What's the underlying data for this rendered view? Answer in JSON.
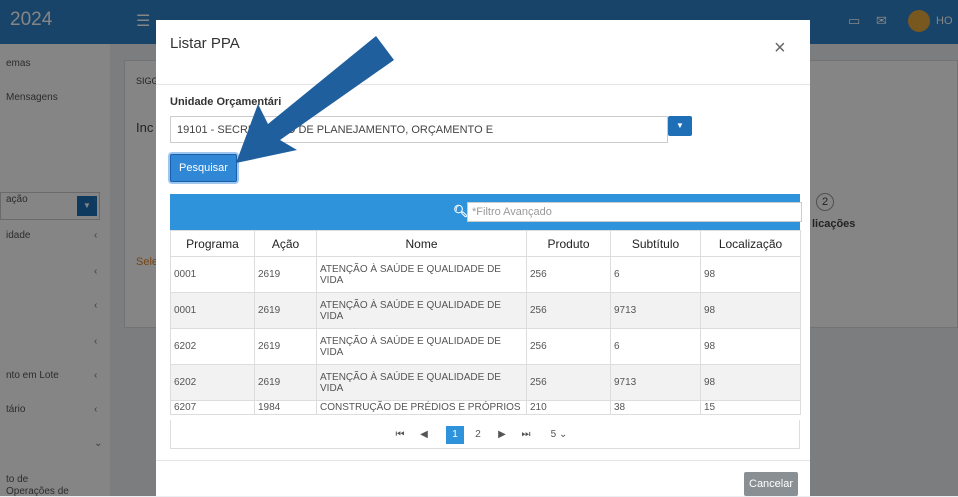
{
  "app": {
    "year": "2024",
    "user": "HO"
  },
  "sidebar": {
    "items": [
      {
        "label": "emas"
      },
      {
        "label": "Mensagens"
      },
      {
        "label": "ação"
      },
      {
        "label": "idade"
      },
      {
        "label": ""
      },
      {
        "label": ""
      },
      {
        "label": ""
      },
      {
        "label": "nto em Lote"
      },
      {
        "label": "tário"
      },
      {
        "label": ""
      },
      {
        "label": "to de"
      },
      {
        "label": "Operações de"
      }
    ]
  },
  "background": {
    "breadcrumb": "SIGG",
    "inc": "Inc",
    "sele": "Sele",
    "step_number": "2",
    "step_label": "licações"
  },
  "modal": {
    "title": "Listar PPA",
    "close": "×",
    "field_label": "Unidade Orçamentári",
    "select_value": "19101 - SECRE     STADO DE PLANEJAMENTO, ORÇAMENTO E",
    "search_button": "Pesquisar",
    "filter_placeholder": "*Filtro Avançado",
    "columns": [
      "Programa",
      "Ação",
      "Nome",
      "Produto",
      "Subtítulo",
      "Localização"
    ],
    "rows": [
      {
        "programa": "0001",
        "acao": "2619",
        "nome": "ATENÇÃO À SAÚDE E QUALIDADE DE VIDA",
        "produto": "256",
        "subtitulo": "6",
        "localizacao": "98"
      },
      {
        "programa": "0001",
        "acao": "2619",
        "nome": "ATENÇÃO À SAÚDE E QUALIDADE DE VIDA",
        "produto": "256",
        "subtitulo": "9713",
        "localizacao": "98"
      },
      {
        "programa": "6202",
        "acao": "2619",
        "nome": "ATENÇÃO À SAÚDE E QUALIDADE DE VIDA",
        "produto": "256",
        "subtitulo": "6",
        "localizacao": "98"
      },
      {
        "programa": "6202",
        "acao": "2619",
        "nome": "ATENÇÃO À SAÚDE E QUALIDADE DE VIDA",
        "produto": "256",
        "subtitulo": "9713",
        "localizacao": "98"
      },
      {
        "programa": "6207",
        "acao": "1984",
        "nome": "CONSTRUÇÃO DE PRÉDIOS E PRÓPRIOS",
        "produto": "210",
        "subtitulo": "38",
        "localizacao": "15"
      }
    ],
    "pager": {
      "first": "⏮",
      "prev": "◀",
      "page1": "1",
      "page2": "2",
      "next": "▶",
      "last": "⏭",
      "size": "5"
    },
    "cancel_button": "Cancelar"
  },
  "colors": {
    "brand": "#2f83c9",
    "filter_bar": "#2f93dc",
    "arrow": "#1f5f9e"
  }
}
